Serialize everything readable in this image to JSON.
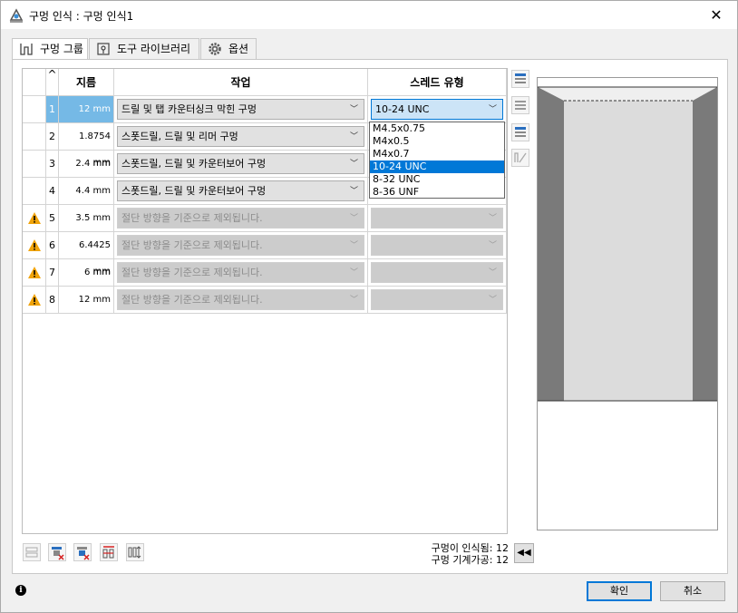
{
  "window": {
    "title": "구멍 인식 : 구멍 인식1",
    "close_glyph": "✕"
  },
  "tabs": [
    {
      "label": "구멍 그룹",
      "icon": "hole-group-icon"
    },
    {
      "label": "도구 라이브러리",
      "icon": "tool-library-icon"
    },
    {
      "label": "옵션",
      "icon": "gear-icon"
    }
  ],
  "table": {
    "sort_glyph": "^",
    "headers": {
      "diameter": "지름",
      "operation": "작업",
      "thread": "스레드 유형"
    },
    "rows": [
      {
        "num": "1",
        "dia": "12 mm",
        "op": "드릴 및 탭 카운터싱크 막힌 구멍",
        "thread": "10-24 UNC",
        "warn": false,
        "disabled": false,
        "selected": true
      },
      {
        "num": "2",
        "dia": "1.8754 mm",
        "op": "스폿드릴, 드릴 및 리머 구멍",
        "thread": "",
        "warn": false,
        "disabled": false,
        "selected": false
      },
      {
        "num": "3",
        "dia": "2.4 mm",
        "op": "스폿드릴, 드릴 및 카운터보어 구멍",
        "thread": "",
        "warn": false,
        "disabled": false,
        "selected": false
      },
      {
        "num": "4",
        "dia": "4.4 mm",
        "op": "스폿드릴, 드릴 및 카운터보어 구멍",
        "thread": "",
        "warn": false,
        "disabled": false,
        "selected": false
      },
      {
        "num": "5",
        "dia": "3.5 mm",
        "op": "절단 방향을 기준으로 제외됩니다.",
        "thread": "",
        "warn": true,
        "disabled": true,
        "selected": false
      },
      {
        "num": "6",
        "dia": "6.4425 mm",
        "op": "절단 방향을 기준으로 제외됩니다.",
        "thread": "",
        "warn": true,
        "disabled": true,
        "selected": false
      },
      {
        "num": "7",
        "dia": "6 mm",
        "op": "절단 방향을 기준으로 제외됩니다.",
        "thread": "",
        "warn": true,
        "disabled": true,
        "selected": false
      },
      {
        "num": "8",
        "dia": "12 mm",
        "op": "절단 방향을 기준으로 제외됩니다.",
        "thread": "",
        "warn": true,
        "disabled": true,
        "selected": false
      }
    ]
  },
  "thread_dropdown": {
    "options": [
      "M4.5x0.75",
      "M4x0.5",
      "M4x0.7",
      "10-24 UNC",
      "8-32 UNC",
      "8-36 UNF"
    ],
    "highlighted": "10-24 UNC"
  },
  "side_toolbar": [
    "expand-rows-icon",
    "collapse-rows-icon",
    "edit-rows-icon",
    "measure-icon"
  ],
  "bottom_toolbar": [
    "unselect-icon",
    "remove-red-icon",
    "remove-blue-icon",
    "split-icon",
    "align-icon"
  ],
  "stats": {
    "recognized": "구멍이 인식됨: 12",
    "machinable": "구멍 기계가공: 12"
  },
  "rewind_glyph": "◀◀",
  "buttons": {
    "ok": "확인",
    "cancel": "취소"
  },
  "info_glyph": "i",
  "colors": {
    "accent": "#0078d7",
    "selected_cell": "#75b9e6",
    "warning": "#f0a30a"
  }
}
